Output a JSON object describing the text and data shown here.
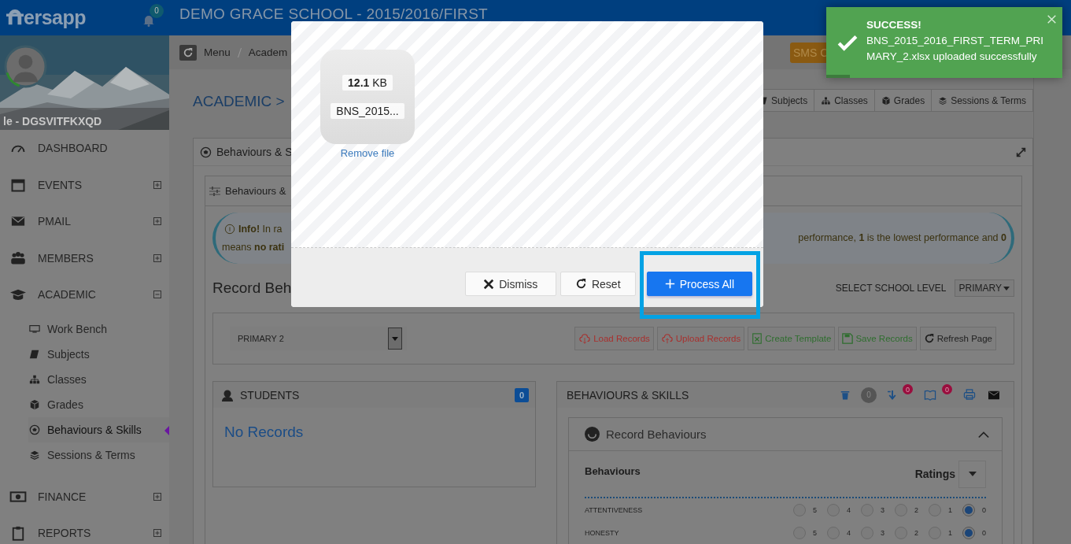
{
  "topbar": {
    "logo": "ersapp",
    "notifications": "0",
    "title": "DEMO GRACE SCHOOL - 2015/2016/FIRST"
  },
  "sidebar": {
    "user": "le - DGSVITFKXQD",
    "items": [
      {
        "kind": "link",
        "label": "DASHBOARD"
      },
      {
        "kind": "group",
        "label": "EVENTS",
        "expanded": false
      },
      {
        "kind": "group",
        "label": "PMAIL",
        "expanded": false
      },
      {
        "kind": "group",
        "label": "MEMBERS",
        "expanded": false
      },
      {
        "kind": "group",
        "label": "ACADEMIC",
        "expanded": true,
        "children": [
          {
            "label": "Work Bench",
            "selected": false
          },
          {
            "label": "Subjects",
            "selected": false
          },
          {
            "label": "Classes",
            "selected": false
          },
          {
            "label": "Grades",
            "selected": false
          },
          {
            "label": "Behaviours & Skills",
            "selected": true
          },
          {
            "label": "Sessions & Terms",
            "selected": false
          }
        ]
      },
      {
        "kind": "group",
        "label": "FINANCE",
        "expanded": false
      },
      {
        "kind": "group",
        "label": "REPORTS",
        "expanded": false
      }
    ]
  },
  "breadcrumb": [
    "Menu",
    "Academ"
  ],
  "sms_button": "SMS C",
  "page_title": "ACADEMIC >",
  "quick_tabs": [
    "Subjects",
    "Classes",
    "Grades",
    "Sessions & Terms"
  ],
  "panel": {
    "title": "Behaviours & S",
    "subtab": "Behaviours &",
    "info": {
      "line_1": "**Info!** In ra",
      "line_2": "means **no rati**",
      "right": "performance, **1** is the lowest performance and **0**"
    },
    "record_heading": "Record Beh",
    "level_label": "SELECT SCHOOL LEVEL",
    "level_value": "PRIMARY",
    "class_select": "PRIMARY 2",
    "actions": [
      {
        "label": "Load Records",
        "color": "#a8302e"
      },
      {
        "label": "Upload Records",
        "color": "#a8302e"
      },
      {
        "label": "Create Template",
        "color": "#2f6e2f"
      },
      {
        "label": "Save Records",
        "color": "#2f6e2f"
      },
      {
        "label": "Refresh Page",
        "color": "#1e1e1e"
      }
    ],
    "students": {
      "title": "STUDENTS",
      "count": "0",
      "empty": "No Records"
    },
    "behaviours": {
      "title": "BEHAVIOURS & SKILLS",
      "count": "0",
      "download_badge": "0",
      "book_badge": "0",
      "section": {
        "title": "Record Behaviours",
        "expanded": true,
        "column_title": "Behaviours",
        "ratings_label": "Ratings",
        "rows": [
          {
            "name": "ATTENTIVENESS",
            "options": [
              {
                "label": "5",
                "selected": false
              },
              {
                "label": "4",
                "selected": false
              },
              {
                "label": "3",
                "selected": false
              },
              {
                "label": "2",
                "selected": false
              },
              {
                "label": "1",
                "selected": false
              },
              {
                "label": "0",
                "selected": true
              }
            ]
          },
          {
            "name": "HONESTY",
            "options": [
              {
                "label": "5",
                "selected": false
              },
              {
                "label": "4",
                "selected": false
              },
              {
                "label": "3",
                "selected": false
              },
              {
                "label": "2",
                "selected": false
              },
              {
                "label": "1",
                "selected": false
              },
              {
                "label": "0",
                "selected": true
              }
            ]
          }
        ]
      }
    }
  },
  "modal": {
    "file": {
      "size": "**12.1** KB",
      "name": "BNS_2015..."
    },
    "remove": "Remove file",
    "buttons": [
      {
        "kind": "dismiss",
        "label": "Dismiss",
        "highlighted": false
      },
      {
        "kind": "reset",
        "label": "Reset",
        "highlighted": false
      },
      {
        "kind": "primary",
        "label": "Process All",
        "highlighted": true
      }
    ]
  },
  "toast": {
    "title": "SUCCESS!",
    "message": "BNS_2015_2016_FIRST_TERM_PRIMARY_2.xlsx uploaded successfully",
    "level": 0.1
  }
}
